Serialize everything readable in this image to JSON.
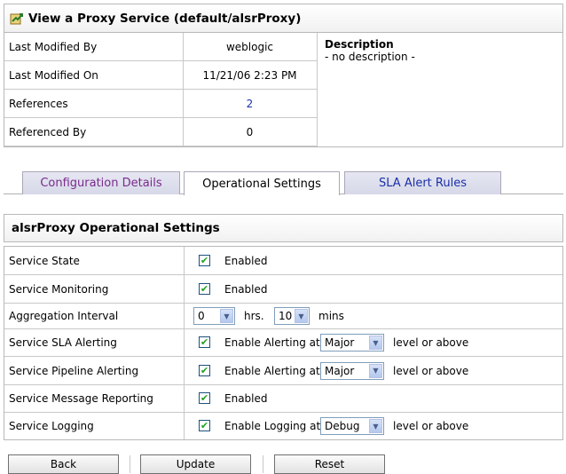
{
  "header": {
    "title": "View a Proxy Service (default/alsrProxy)",
    "icon": "proxy-service-icon"
  },
  "summary": {
    "rows": [
      {
        "label": "Last Modified By",
        "value": "weblogic"
      },
      {
        "label": "Last Modified On",
        "value": "11/21/06 2:23 PM"
      },
      {
        "label": "References",
        "value": "2"
      },
      {
        "label": "Referenced By",
        "value": "0"
      }
    ],
    "description_heading": "Description",
    "description_text": "- no description -"
  },
  "tabs": [
    {
      "label": "Configuration Details",
      "active": false
    },
    {
      "label": "Operational Settings",
      "active": true
    },
    {
      "label": "SLA Alert Rules",
      "active": false
    }
  ],
  "section": {
    "title": "alsrProxy Operational Settings"
  },
  "settings": {
    "service_state": {
      "label": "Service State",
      "checked": true,
      "text": "Enabled"
    },
    "service_monitoring": {
      "label": "Service Monitoring",
      "checked": true,
      "text": "Enabled"
    },
    "aggregation_interval": {
      "label": "Aggregation Interval",
      "hours": "0",
      "hours_unit": "hrs.",
      "minutes": "10",
      "minutes_unit": "mins"
    },
    "sla_alerting": {
      "label": "Service SLA Alerting",
      "checked": true,
      "text": "Enable Alerting at",
      "level": "Major",
      "suffix": "level or above"
    },
    "pipeline_alerting": {
      "label": "Service Pipeline Alerting",
      "checked": true,
      "text": "Enable Alerting at",
      "level": "Major",
      "suffix": "level or above"
    },
    "message_reporting": {
      "label": "Service Message Reporting",
      "checked": true,
      "text": "Enabled"
    },
    "logging": {
      "label": "Service Logging",
      "checked": true,
      "text": "Enable Logging at",
      "level": "Debug",
      "suffix": "level or above"
    }
  },
  "buttons": {
    "back": "Back",
    "update": "Update",
    "reset": "Reset"
  },
  "colors": {
    "link": "#1a2fa8",
    "visited_tab": "#7a2a8c",
    "check": "#21a121"
  }
}
